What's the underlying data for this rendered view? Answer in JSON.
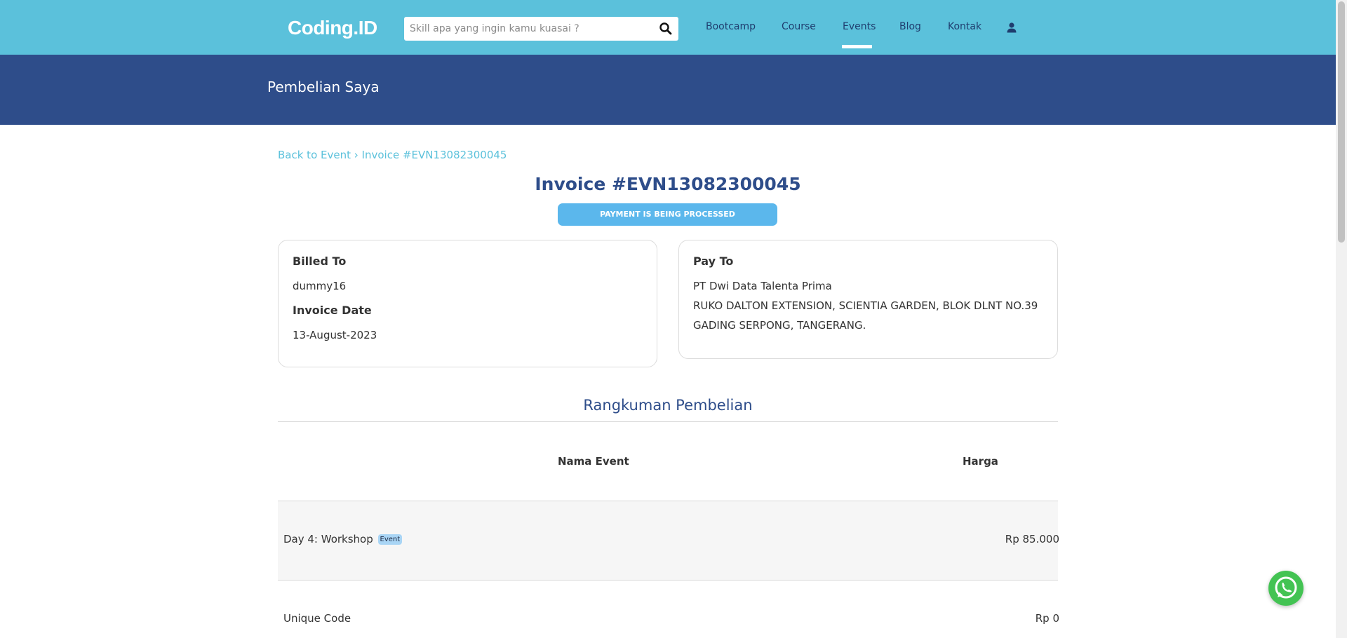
{
  "nav": {
    "logo": "Coding.ID",
    "search_placeholder": "Skill apa yang ingin kamu kuasai ?",
    "items": [
      "Bootcamp",
      "Course",
      "Events",
      "Blog",
      "Kontak"
    ],
    "active_item": "Events",
    "icons": {
      "search": "search-icon",
      "user": "user-icon"
    }
  },
  "header": {
    "title": "Pembelian Saya"
  },
  "breadcrumb": {
    "back": "Back to Event",
    "separator": "›",
    "current": "Invoice #EVN13082300045"
  },
  "invoice": {
    "title": "Invoice #EVN13082300045",
    "status": "PAYMENT IS BEING PROCESSED"
  },
  "billed": {
    "billed_to_label": "Billed To",
    "billed_to_value": "dummy16",
    "invoice_date_label": "Invoice Date",
    "invoice_date_value": "13-August-2023"
  },
  "pay_to": {
    "label": "Pay To",
    "company": "PT Dwi Data Talenta Prima",
    "address_line1": "RUKO DALTON EXTENSION, SCIENTIA GARDEN, BLOK DLNT NO.39",
    "address_line2": "GADING SERPONG, TANGERANG."
  },
  "summary": {
    "title": "Rangkuman Pembelian",
    "col_name": "Nama Event",
    "col_price": "Harga",
    "item": {
      "name": "Day 4: Workshop",
      "badge": "Event",
      "price": "Rp 85.000"
    },
    "unique_code": {
      "label": "Unique Code",
      "value": "Rp 0"
    }
  },
  "colors": {
    "navbar": "#5bc1db",
    "header": "#2e4d8a",
    "status_badge": "#5bb7ec",
    "whatsapp": "#43c353"
  }
}
